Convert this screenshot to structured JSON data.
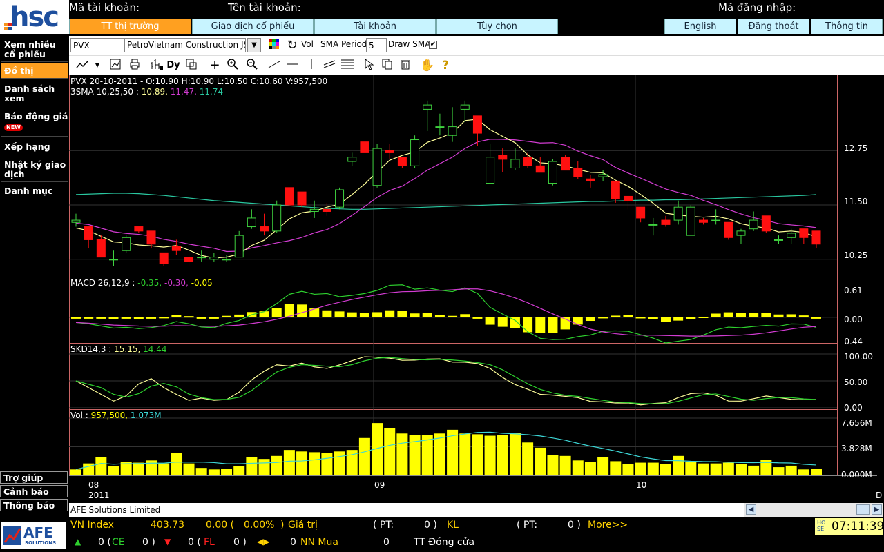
{
  "brand": {
    "logo_text": "hsc",
    "footer_logo_text": "AFE",
    "footer_logo_sub": "SOLUTIONS"
  },
  "header": {
    "account_no_label": "Mã tài khoản:",
    "account_name_label": "Tên tài khoản:",
    "login_label": "Mã đăng nhập:"
  },
  "nav": {
    "tabs": [
      "TT thị trường",
      "Giao dịch cổ phiếu",
      "Tài khoản",
      "Tùy chọn"
    ],
    "right_tabs": [
      "English",
      "Đăng thoát",
      "Thông tin"
    ]
  },
  "sidebar": {
    "items": [
      "Xem nhiều cổ phiếu",
      "Đồ thị",
      "Danh sách xem",
      "Báo động giá",
      "Xếp hạng",
      "Nhật ký giao dịch",
      "Danh mục"
    ],
    "new_badge": "NEW",
    "bottom": [
      "Trợ giúp",
      "Cảnh báo",
      "Thông báo"
    ]
  },
  "toolbar": {
    "symbol_value": "PVX",
    "company_value": "PetroVietnam Construction JSC",
    "vol_label": "Vol",
    "sma_period_label": "SMA Period:",
    "sma_period_value": "5",
    "draw_sma_label": "Draw SMA:",
    "draw_sma_checked": true
  },
  "chart_data": {
    "type": "candlestick",
    "symbol": "PVX",
    "price_header": "PVX 20-10-2011 - O:10.90 H:10.90 L:10.50 C:10.60 V:957,500",
    "sma_label": "3SMA 10,25,50 :",
    "sma_values": [
      "10.89,",
      "11.47,",
      "11.74"
    ],
    "macd_label": "MACD 26,12,9 :",
    "macd_values": [
      "-0.35,",
      "-0.30,",
      "-0.05"
    ],
    "skd_label": "SKD14,3 :",
    "skd_values": [
      "15.15,",
      "14.44"
    ],
    "vol_label": "Vol :",
    "vol_values": [
      "957,500,",
      "1.073M"
    ],
    "price_ticks": [
      "12.75",
      "11.50",
      "10.25"
    ],
    "macd_ticks": [
      "0.61",
      "0.00",
      "-0.44"
    ],
    "skd_ticks": [
      "100.00",
      "50.00",
      "0.00"
    ],
    "vol_ticks": [
      "7.656M",
      "3.828M",
      "0.000M"
    ],
    "x_ticks": [
      "08",
      "09",
      "10"
    ],
    "x_year": "2011",
    "x_corner": "D",
    "colors": {
      "up": "#3fd23f",
      "down": "#ff1010",
      "sma10": "#ffff9a",
      "sma25": "#d23cd2",
      "sma50": "#2ac7a0",
      "volume": "#ffff00",
      "volavg": "#3dd6d6",
      "macd_hist": "#ffff00",
      "macd": "#2ed02e",
      "signal": "#d23cd2",
      "k": "#ffff9a",
      "d": "#2ed02e"
    },
    "candles": [
      {
        "o": 11.1,
        "h": 11.3,
        "l": 11.0,
        "c": 11.15
      },
      {
        "o": 11.0,
        "h": 11.0,
        "l": 10.5,
        "c": 10.7
      },
      {
        "o": 10.7,
        "h": 10.8,
        "l": 10.3,
        "c": 10.3
      },
      {
        "o": 10.25,
        "h": 10.45,
        "l": 10.1,
        "c": 10.25
      },
      {
        "o": 10.45,
        "h": 10.8,
        "l": 10.4,
        "c": 10.75
      },
      {
        "o": 11.0,
        "h": 11.0,
        "l": 10.85,
        "c": 10.9
      },
      {
        "o": 10.9,
        "h": 10.9,
        "l": 10.5,
        "c": 10.6
      },
      {
        "o": 10.4,
        "h": 10.4,
        "l": 10.1,
        "c": 10.15
      },
      {
        "o": 10.55,
        "h": 10.7,
        "l": 10.35,
        "c": 10.45
      },
      {
        "o": 10.3,
        "h": 10.4,
        "l": 10.1,
        "c": 10.2
      },
      {
        "o": 10.3,
        "h": 10.45,
        "l": 10.2,
        "c": 10.3
      },
      {
        "o": 10.25,
        "h": 10.4,
        "l": 10.2,
        "c": 10.3
      },
      {
        "o": 10.25,
        "h": 10.35,
        "l": 10.2,
        "c": 10.25
      },
      {
        "o": 10.3,
        "h": 10.9,
        "l": 10.3,
        "c": 10.8
      },
      {
        "o": 11.0,
        "h": 11.4,
        "l": 10.95,
        "c": 11.2
      },
      {
        "o": 11.0,
        "h": 11.3,
        "l": 10.8,
        "c": 10.9
      },
      {
        "o": 10.9,
        "h": 11.6,
        "l": 10.85,
        "c": 11.5
      },
      {
        "o": 11.9,
        "h": 11.9,
        "l": 11.5,
        "c": 11.5
      },
      {
        "o": 11.8,
        "h": 11.8,
        "l": 11.45,
        "c": 11.5
      },
      {
        "o": 11.35,
        "h": 11.6,
        "l": 11.2,
        "c": 11.4
      },
      {
        "o": 11.4,
        "h": 11.55,
        "l": 11.25,
        "c": 11.35
      },
      {
        "o": 11.45,
        "h": 11.9,
        "l": 11.4,
        "c": 11.85
      },
      {
        "o": 12.5,
        "h": 12.7,
        "l": 12.4,
        "c": 12.6
      },
      {
        "o": 12.95,
        "h": 12.95,
        "l": 12.7,
        "c": 12.7
      },
      {
        "o": 11.95,
        "h": 12.9,
        "l": 11.9,
        "c": 12.8
      },
      {
        "o": 12.75,
        "h": 12.9,
        "l": 12.55,
        "c": 12.7
      },
      {
        "o": 12.6,
        "h": 12.6,
        "l": 12.35,
        "c": 12.4
      },
      {
        "o": 12.4,
        "h": 13.1,
        "l": 12.35,
        "c": 13.0
      },
      {
        "o": 13.7,
        "h": 13.9,
        "l": 13.2,
        "c": 13.8
      },
      {
        "o": 13.3,
        "h": 13.6,
        "l": 13.1,
        "c": 13.3
      },
      {
        "o": 13.1,
        "h": 13.75,
        "l": 12.95,
        "c": 13.3
      },
      {
        "o": 13.7,
        "h": 13.9,
        "l": 13.4,
        "c": 13.8
      },
      {
        "o": 13.55,
        "h": 13.55,
        "l": 12.85,
        "c": 13.15
      },
      {
        "o": 12.0,
        "h": 12.9,
        "l": 12.0,
        "c": 12.6
      },
      {
        "o": 12.65,
        "h": 12.8,
        "l": 12.25,
        "c": 12.55
      },
      {
        "o": 12.35,
        "h": 12.8,
        "l": 12.3,
        "c": 12.55
      },
      {
        "o": 12.6,
        "h": 12.7,
        "l": 12.35,
        "c": 12.4
      },
      {
        "o": 12.4,
        "h": 12.6,
        "l": 12.3,
        "c": 12.25
      },
      {
        "o": 12.0,
        "h": 12.55,
        "l": 11.95,
        "c": 12.5
      },
      {
        "o": 12.6,
        "h": 12.65,
        "l": 12.3,
        "c": 12.3
      },
      {
        "o": 12.35,
        "h": 12.5,
        "l": 12.1,
        "c": 12.15
      },
      {
        "o": 12.1,
        "h": 12.2,
        "l": 11.9,
        "c": 12.05
      },
      {
        "o": 12.15,
        "h": 12.3,
        "l": 12.05,
        "c": 12.2
      },
      {
        "o": 12.05,
        "h": 12.05,
        "l": 11.55,
        "c": 11.65
      },
      {
        "o": 11.7,
        "h": 11.7,
        "l": 11.4,
        "c": 11.6
      },
      {
        "o": 11.45,
        "h": 11.45,
        "l": 11.1,
        "c": 11.2
      },
      {
        "o": 11.05,
        "h": 11.2,
        "l": 10.8,
        "c": 11.05
      },
      {
        "o": 11.15,
        "h": 11.25,
        "l": 11.0,
        "c": 11.05
      },
      {
        "o": 11.15,
        "h": 11.6,
        "l": 11.05,
        "c": 11.45
      },
      {
        "o": 10.8,
        "h": 11.5,
        "l": 10.8,
        "c": 11.45
      },
      {
        "o": 11.15,
        "h": 11.2,
        "l": 11.05,
        "c": 11.1
      },
      {
        "o": 11.15,
        "h": 11.4,
        "l": 11.05,
        "c": 11.15
      },
      {
        "o": 11.1,
        "h": 11.1,
        "l": 10.7,
        "c": 10.75
      },
      {
        "o": 10.8,
        "h": 10.95,
        "l": 10.6,
        "c": 10.9
      },
      {
        "o": 10.95,
        "h": 11.35,
        "l": 10.9,
        "c": 11.15
      },
      {
        "o": 11.25,
        "h": 11.25,
        "l": 10.85,
        "c": 10.9
      },
      {
        "o": 10.7,
        "h": 10.8,
        "l": 10.6,
        "c": 10.7
      },
      {
        "o": 10.75,
        "h": 10.95,
        "l": 10.6,
        "c": 10.85
      },
      {
        "o": 10.95,
        "h": 10.95,
        "l": 10.6,
        "c": 10.75
      },
      {
        "o": 10.9,
        "h": 10.9,
        "l": 10.5,
        "c": 10.6
      }
    ],
    "volume_m": [
      0.8,
      1.6,
      2.4,
      1.2,
      1.8,
      1.7,
      2.0,
      1.6,
      3.0,
      1.6,
      1.0,
      0.8,
      0.9,
      1.2,
      2.4,
      2.2,
      2.6,
      3.4,
      3.2,
      3.1,
      3.0,
      3.2,
      3.4,
      5.0,
      7.0,
      6.3,
      5.6,
      5.4,
      5.4,
      5.6,
      6.1,
      5.6,
      5.5,
      5.3,
      5.4,
      5.7,
      4.4,
      3.7,
      2.7,
      2.6,
      2.0,
      1.8,
      2.4,
      1.9,
      1.5,
      1.7,
      1.7,
      1.5,
      2.6,
      1.8,
      1.6,
      1.6,
      1.7,
      1.5,
      1.3,
      2.1,
      1.1,
      1.3,
      0.8,
      0.9
    ]
  },
  "source_text": "AFE Solutions Limited",
  "market": {
    "index_name": "VN Index",
    "index_value": "403.73",
    "change": "0.00 (",
    "change_pct": "0.00%",
    "close_paren": ")",
    "gia_tri": "Giá trị",
    "pt1_label": "( PT:",
    "pt1_value": "0 )",
    "kl": "KL",
    "pt2_label": "( PT:",
    "pt2_value": "0 )",
    "more": "More>>",
    "up_count": "0 (",
    "ce_label": "CE",
    "ce_value": "0 )",
    "down_count": "0 (",
    "fl_label": "FL",
    "fl_value": "0 )",
    "ref_count": "0",
    "nn_mua": "NN Mua",
    "nn_value": "0",
    "status": "TT Đóng cửa",
    "exchange_badge": "HOSE",
    "time": "07:11:39"
  }
}
